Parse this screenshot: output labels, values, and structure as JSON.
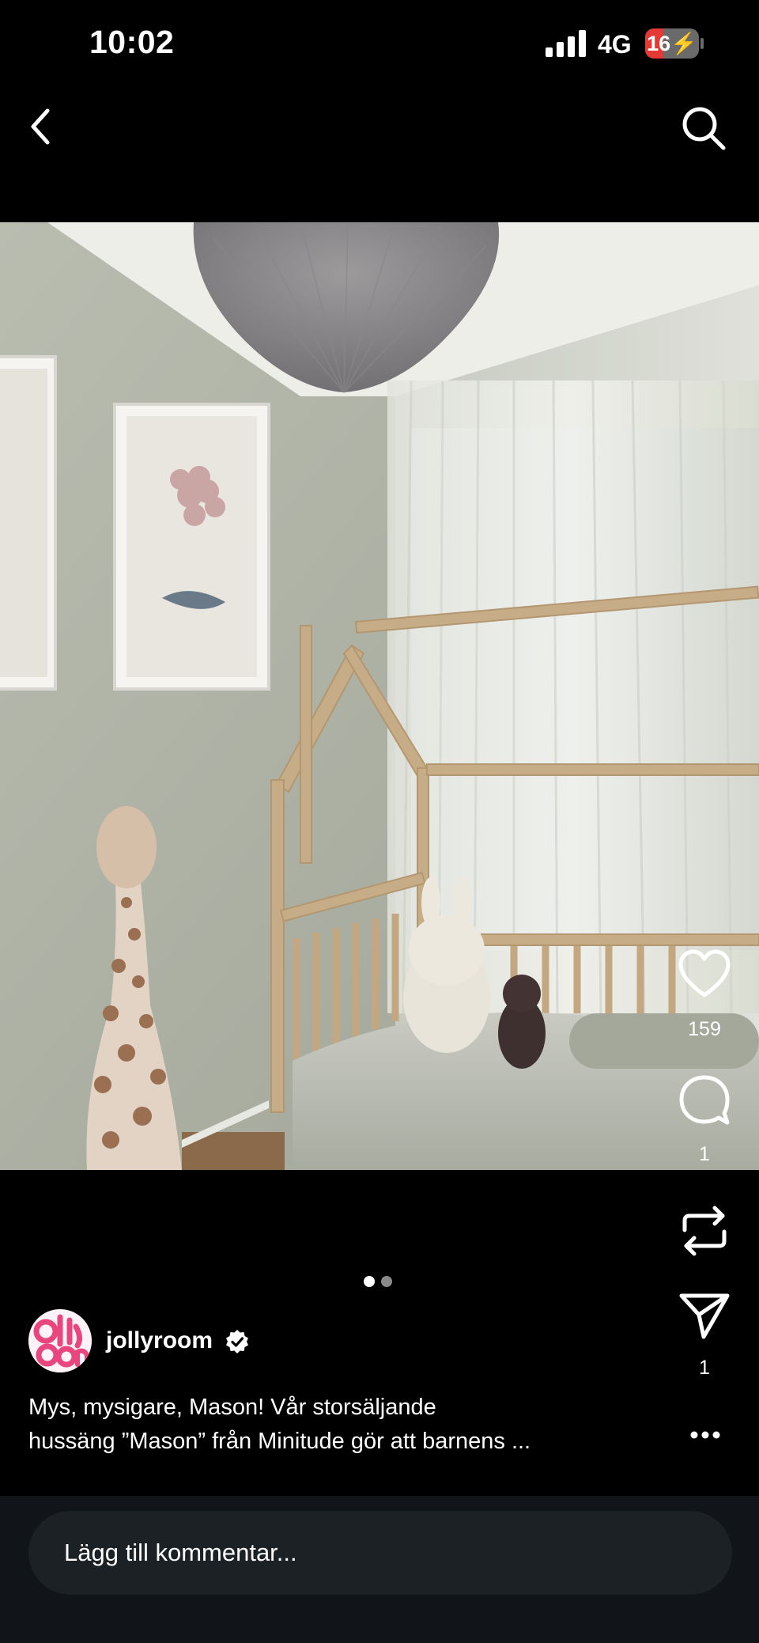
{
  "status_bar": {
    "time": "10:02",
    "network": "4G",
    "battery_text": "16",
    "battery_level_percent": 16,
    "battery_color": "#e53935"
  },
  "nav": {
    "back_icon": "chevron-left-icon",
    "search_icon": "search-icon"
  },
  "post": {
    "image_description_icon": "photo",
    "carousel": {
      "total": 2,
      "current": 1
    },
    "actions": {
      "likes": "159",
      "comments": "1",
      "shares": "1"
    },
    "author": {
      "username": "jollyroom",
      "verified": true,
      "avatar_color": "#e8467c"
    },
    "caption_lines": [
      "Mys, mysigare, Mason! Vår storsäljande",
      "hussäng ”Mason” från Minitude gör att barnens ..."
    ]
  },
  "comment": {
    "placeholder": "Lägg till kommentar..."
  }
}
